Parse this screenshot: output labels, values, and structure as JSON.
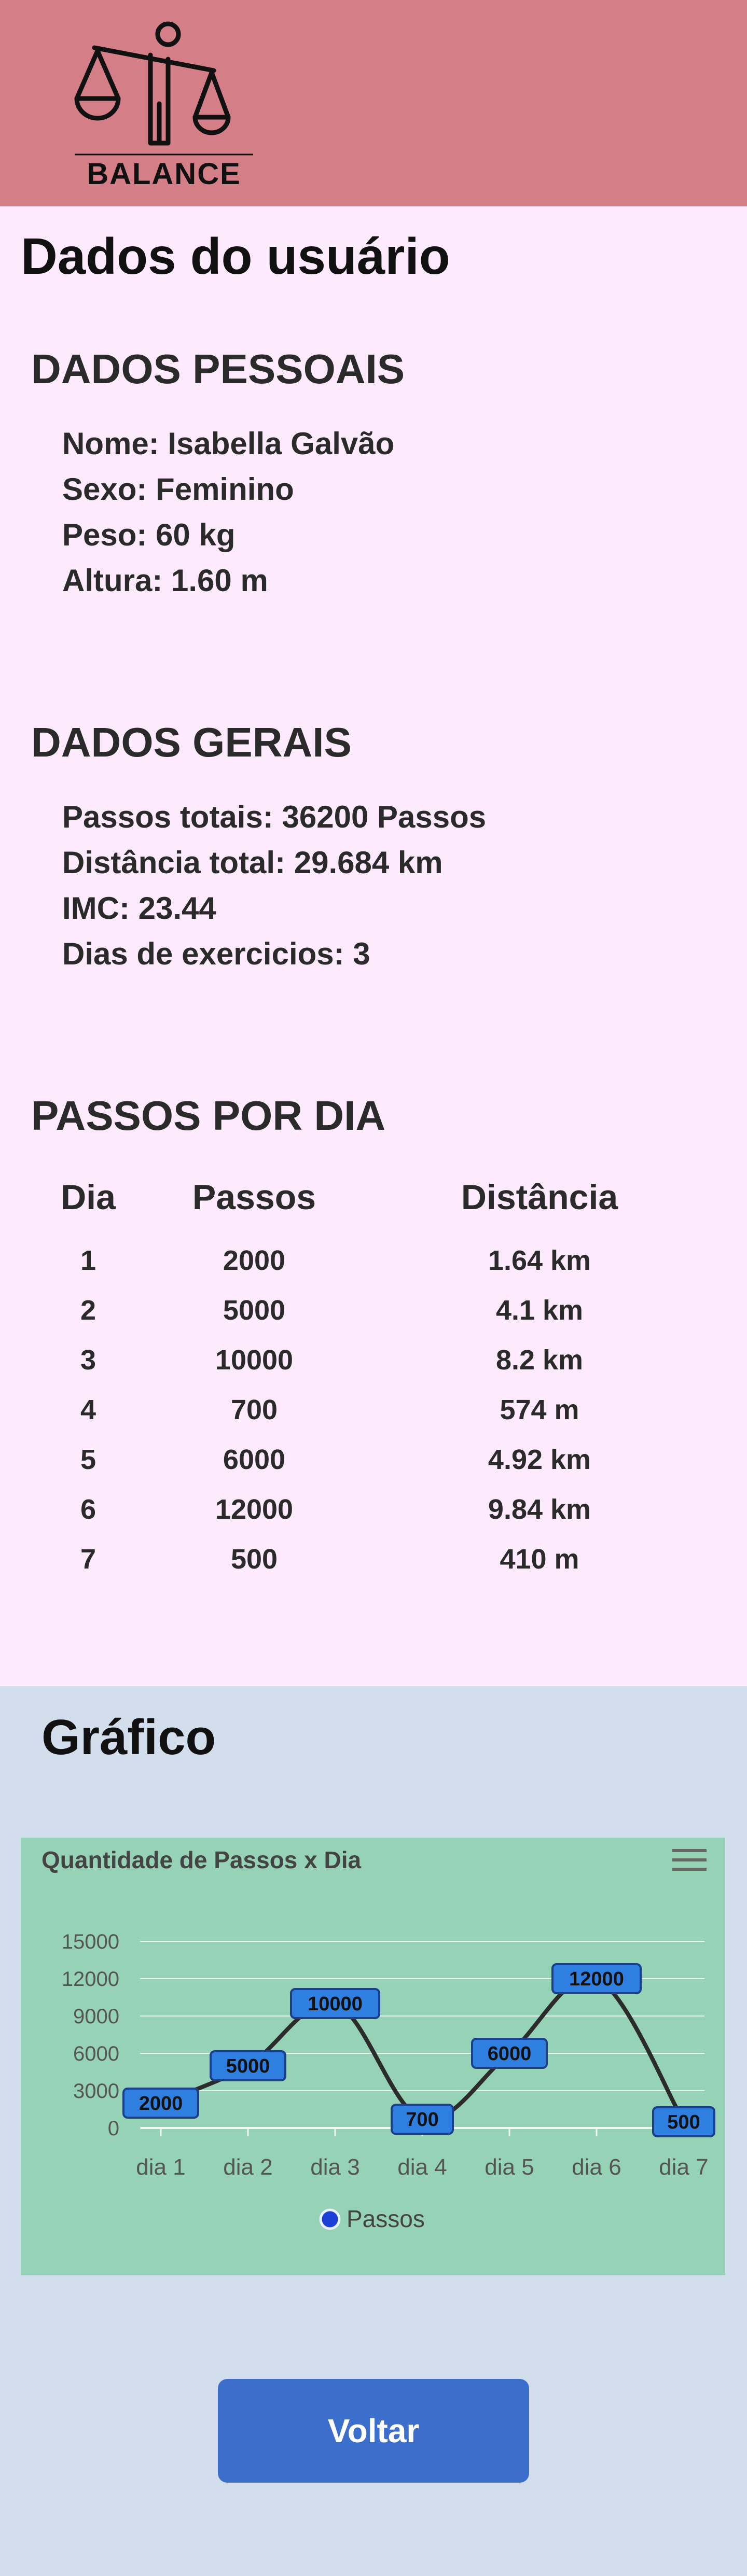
{
  "header": {
    "logo_text": "BALANCE",
    "background_color": "#d47f87",
    "logo_icon": "balance-scale-person-icon"
  },
  "page_title": "Dados do usuário",
  "personal": {
    "title": "DADOS PESSOAIS",
    "nome": "Nome: Isabella Galvão",
    "sexo": "Sexo: Feminino",
    "peso": "Peso: 60 kg",
    "altura": "Altura: 1.60 m"
  },
  "general": {
    "title": "DADOS GERAIS",
    "passos": "Passos totais: 36200 Passos",
    "distancia": "Distância total: 29.684 km",
    "imc": "IMC: 23.44",
    "dias": "Dias de exercicios: 3"
  },
  "steps_table": {
    "title": "PASSOS POR DIA",
    "headers": [
      "Dia",
      "Passos",
      "Distância"
    ],
    "rows": [
      [
        "1",
        "2000",
        "1.64 km"
      ],
      [
        "2",
        "5000",
        "4.1 km"
      ],
      [
        "3",
        "10000",
        "8.2 km"
      ],
      [
        "4",
        "700",
        "574 m"
      ],
      [
        "5",
        "6000",
        "4.92 km"
      ],
      [
        "6",
        "12000",
        "9.84 km"
      ],
      [
        "7",
        "500",
        "410 m"
      ]
    ]
  },
  "chart_section": {
    "title": "Gráfico",
    "background_color": "#d3deec"
  },
  "chart_data": {
    "type": "line",
    "title": "Quantidade de Passos x Dia",
    "categories": [
      "dia 1",
      "dia 2",
      "dia 3",
      "dia 4",
      "dia 5",
      "dia 6",
      "dia 7"
    ],
    "series": [
      {
        "name": "Passos",
        "values": [
          2000,
          5000,
          10000,
          700,
          6000,
          12000,
          500
        ],
        "color": "#2f7fe0"
      }
    ],
    "ylim": [
      0,
      15000
    ],
    "yticks": [
      0,
      3000,
      6000,
      9000,
      12000,
      15000
    ],
    "grid": true,
    "legend": "bottom-center",
    "data_labels": true,
    "background_color": "#96d2b6"
  },
  "buttons": {
    "back": "Voltar",
    "back_color": "#3c6fcb"
  }
}
